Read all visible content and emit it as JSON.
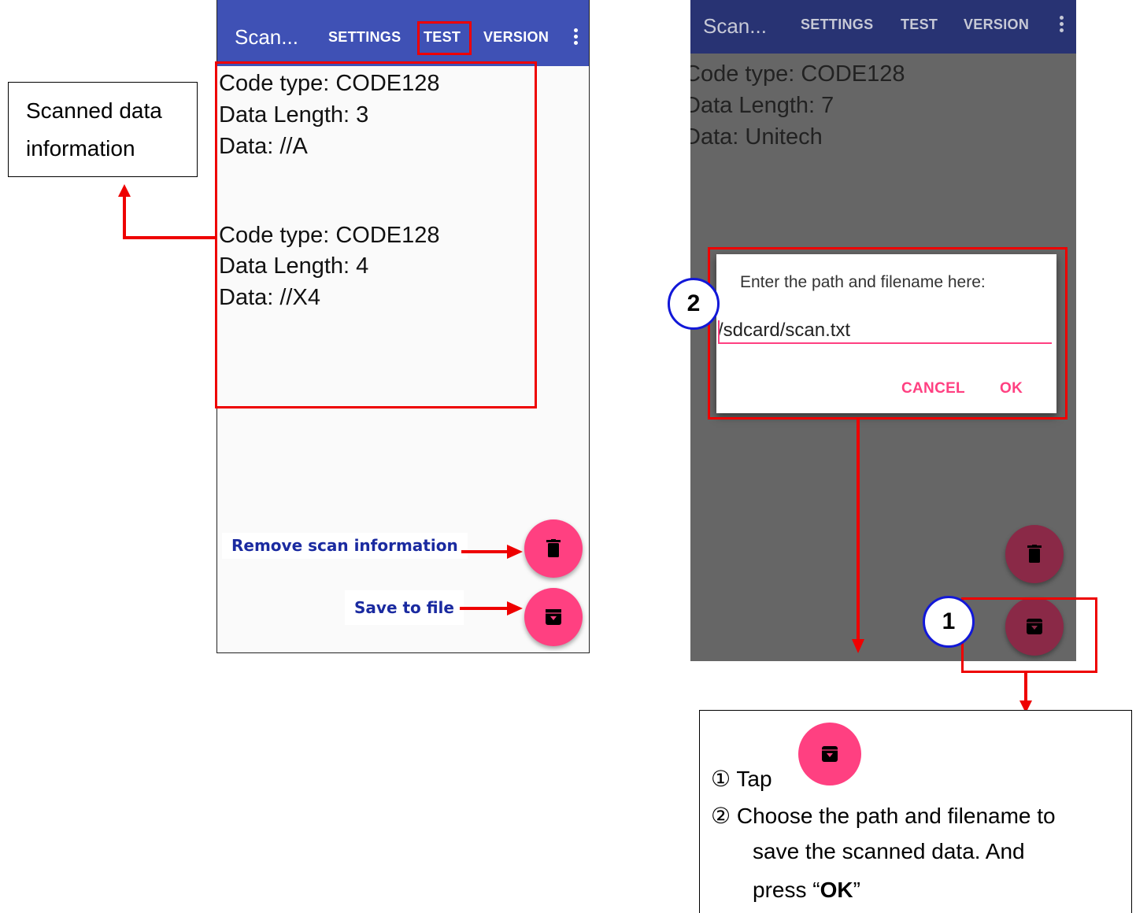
{
  "left_phone": {
    "app_title": "Scan...",
    "tabs": [
      "SETTINGS",
      "TEST",
      "VERSION"
    ],
    "scan_entries": [
      {
        "code_type": "Code type: CODE128",
        "data_length": "Data Length: 3",
        "data": "Data: //A"
      },
      {
        "code_type": "Code type: CODE128",
        "data_length": "Data Length: 4",
        "data": "Data: //X4"
      }
    ],
    "callout_remove": "Remove scan information",
    "callout_save": "Save to file"
  },
  "annotation_left": {
    "line1": "Scanned data",
    "line2": "information"
  },
  "right_phone": {
    "app_title": "Scan...",
    "tabs": [
      "SETTINGS",
      "TEST",
      "VERSION"
    ],
    "scan_entry": {
      "code_type": "Code type: CODE128",
      "data_length": "Data Length: 7",
      "data": "Data: Unitech"
    },
    "dialog": {
      "prompt": "Enter the path and filename here:",
      "path_value": "/sdcard/scan.txt",
      "cancel_label": "CANCEL",
      "ok_label": "OK"
    }
  },
  "badges": {
    "one": "1",
    "two": "2"
  },
  "instructions": {
    "step1": "① Tap",
    "step2_line1": "② Choose the path and filename to",
    "step2_line2": "save the scanned data. And",
    "step2_line3_prefix": "press “",
    "step2_line3_bold": "OK",
    "step2_line3_suffix": "”"
  },
  "colors": {
    "appbar": "#3f51b5",
    "accent": "#ff4081",
    "annotation_red": "#e00000",
    "badge_border": "#1218d8"
  }
}
